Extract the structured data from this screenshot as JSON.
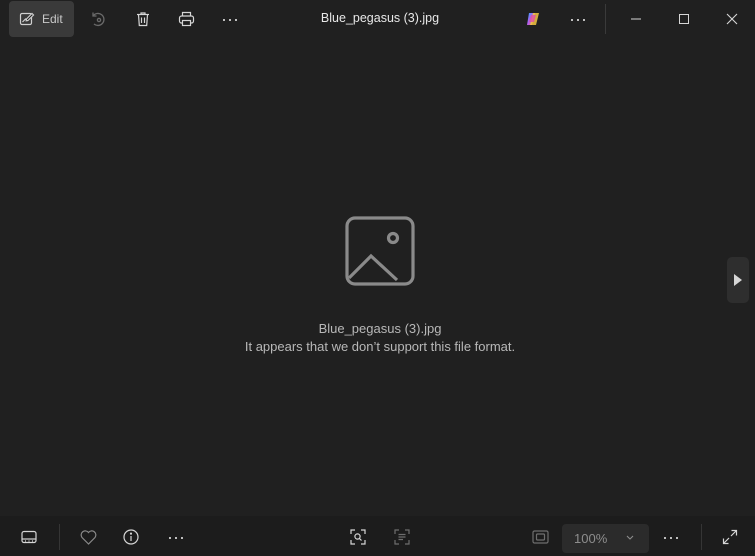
{
  "toolbar": {
    "edit_label": "Edit",
    "title": "Blue_pegasus (3).jpg",
    "more_label": "···"
  },
  "viewer": {
    "file_name": "Blue_pegasus (3).jpg",
    "message": "It appears that we don’t support this file format."
  },
  "bottom": {
    "zoom": "100%",
    "more_label": "···"
  },
  "colors": {
    "background": "#202020",
    "toolbar_active": "#3a3a3a",
    "muted_text": "#b8b8b8"
  }
}
